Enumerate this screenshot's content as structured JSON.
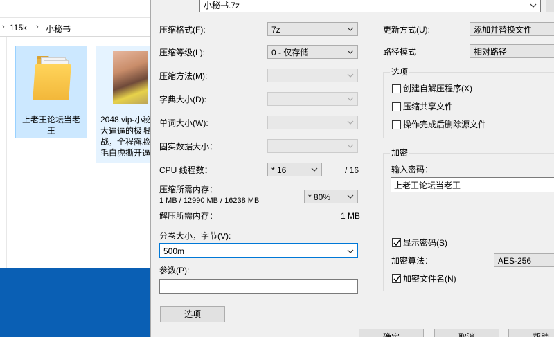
{
  "explorer": {
    "breadcrumb": [
      "115k",
      "小秘书"
    ],
    "items": [
      {
        "name": "上老王论坛当老\n王",
        "icon": "folder-icon"
      },
      {
        "name": "2048.vip-小秘\n大逼逼的极限\n战，全程露脸\n毛白虎撕开逼",
        "icon": "image-thumbnail"
      }
    ]
  },
  "dialog": {
    "archive_name": "小秘书.7z",
    "format_label": "压缩格式(F):",
    "format_value": "7z",
    "level_label": "压缩等级(L):",
    "level_value": "0 - 仅存储",
    "method_label": "压缩方法(M):",
    "dict_label": "字典大小(D):",
    "word_label": "单词大小(W):",
    "solid_label": "固实数据大小：",
    "cpu_label": "CPU 线程数：",
    "cpu_value": "* 16",
    "cpu_max": "/ 16",
    "mem_label": "压缩所需内存：",
    "mem_detail": "1 MB / 12990 MB / 16238 MB",
    "mem_percent": "* 80%",
    "decomp_label": "解压所需内存：",
    "decomp_value": "1 MB",
    "volume_label": "分卷大小，字节(V):",
    "volume_value": "500m",
    "params_label": "参数(P):",
    "params_value": "",
    "options_button": "选项",
    "update_label": "更新方式(U):",
    "update_value": "添加并替换文件",
    "path_label": "路径模式",
    "path_value": "相对路径",
    "options_group": "选项",
    "opt_sfx": "创建自解压程序(X)",
    "opt_shared": "压缩共享文件",
    "opt_delete": "操作完成后删除源文件",
    "encrypt_group": "加密",
    "password_label": "输入密码：",
    "password_value": "上老王论坛当老王",
    "show_password": "显示密码(S)",
    "enc_method_label": "加密算法：",
    "enc_method_value": "AES-256",
    "encrypt_names": "加密文件名(N)",
    "ok_button": "确定",
    "cancel_button": "取消",
    "help_button": "帮助"
  }
}
